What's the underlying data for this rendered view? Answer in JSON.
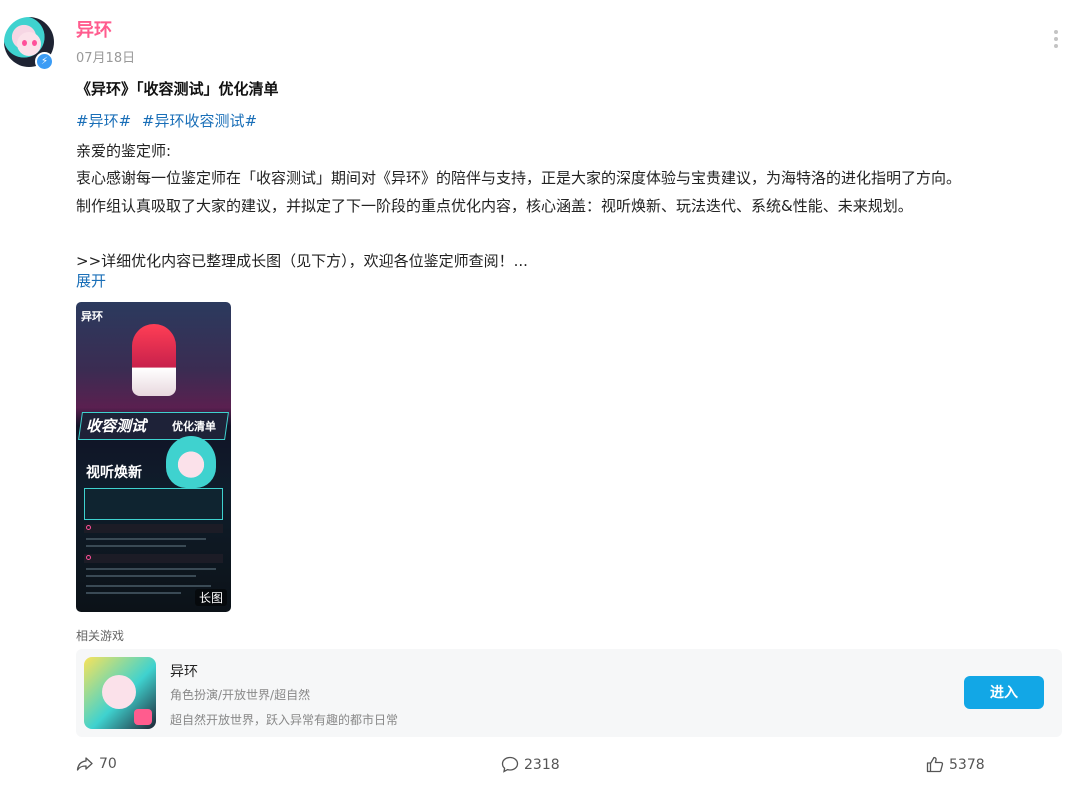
{
  "author": {
    "name": "异环",
    "date": "07月18日"
  },
  "post": {
    "title": "《异环》「收容测试」优化清单",
    "tags": [
      "#异环#",
      "#异环收容测试#"
    ],
    "greeting": "亲爱的鉴定师:",
    "line1": "衷心感谢每一位鉴定师在「收容测试」期间对《异环》的陪伴与支持，正是大家的深度体验与宝贵建议，为海特洛的进化指明了方向。",
    "line2": "制作组认真吸取了大家的建议，并拟定了下一阶段的重点优化内容，核心涵盖：视听焕新、玩法迭代、系统&性能、未来规划。",
    "line3": ">>详细优化内容已整理成长图（见下方），欢迎各位鉴定师查阅！...",
    "expand_label": "展开"
  },
  "image": {
    "logo_text": "异环",
    "banner_text": "收容测试",
    "banner_sub": "优化清单",
    "section_text": "视听焕新",
    "badge": "长图"
  },
  "related": {
    "label": "相关游戏",
    "game": {
      "name": "异环",
      "genre": "角色扮演/开放世界/超自然",
      "desc": "超自然开放世界，跃入异常有趣的都市日常",
      "enter_label": "进入"
    }
  },
  "actions": {
    "share_count": "70",
    "comment_count": "2318",
    "like_count": "5378"
  },
  "colors": {
    "author_name": "#ff5c8e",
    "link": "#1a6fb8",
    "enter_button": "#12a7e6"
  }
}
